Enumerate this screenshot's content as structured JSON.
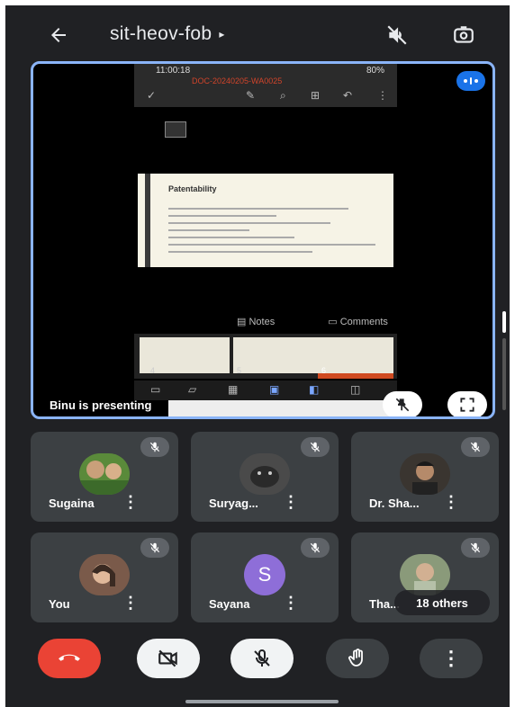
{
  "header": {
    "back_icon": "arrow-left-icon",
    "meeting_code": "sit-heov-fob",
    "caret": "▸",
    "speaker_off_icon": "volume-off-icon",
    "flip_camera_icon": "camera-switch-icon"
  },
  "presentation": {
    "phone_time": "11:00:18",
    "phone_battery": "80%",
    "document_name": "DOC-20240205-WA0025",
    "slide_title": "Patentability",
    "notes_label": "Notes",
    "comments_label": "Comments",
    "thumb_numbers": [
      "4",
      "5",
      "6"
    ],
    "presenter_label": "Binu is presenting",
    "pin_icon": "unpin-icon",
    "fullscreen_icon": "fullscreen-icon",
    "audio_indicator_icon": "audio-level-icon"
  },
  "participants": [
    {
      "name": "Sugaina",
      "avatar": "photo",
      "avatar_color": "#5a8a3a",
      "muted": true
    },
    {
      "name": "Suryag...",
      "avatar": "photo",
      "avatar_color": "#4a4a4a",
      "muted": true
    },
    {
      "name": "Dr. Sha...",
      "avatar": "photo",
      "avatar_color": "#3a3530",
      "muted": true
    },
    {
      "name": "You",
      "avatar": "photo",
      "avatar_color": "#7a5a4a",
      "muted": true
    },
    {
      "name": "Sayana",
      "avatar": "letter",
      "initial": "S",
      "avatar_color": "#8e6ed8",
      "muted": true
    },
    {
      "name": "Tha...",
      "avatar": "photo",
      "avatar_color": "#8a9a7a",
      "muted": true,
      "overlay": "18 others"
    }
  ],
  "controls": {
    "end_call_icon": "end-call-icon",
    "camera_off_icon": "camera-off-icon",
    "mic_off_icon": "mic-off-icon",
    "raise_hand_icon": "raise-hand-icon",
    "more_icon": "more-vert-icon"
  },
  "colors": {
    "background": "#202124",
    "tile": "#3c4043",
    "accent_border": "#8ab4f8",
    "end_call": "#ea4335"
  }
}
